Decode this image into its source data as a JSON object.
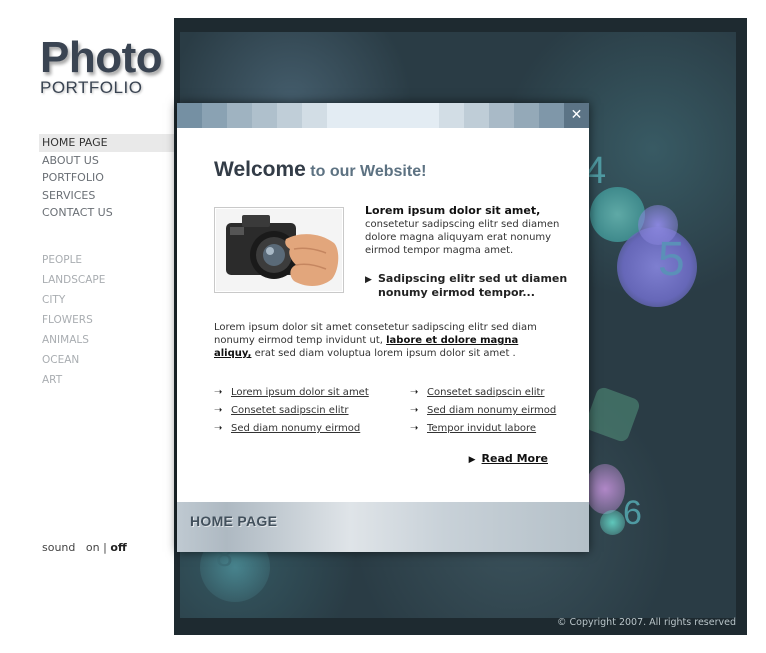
{
  "logo": {
    "title": "Photo",
    "subtitle": "PORTFOLIO"
  },
  "main_nav": [
    {
      "label": "HOME PAGE",
      "active": true
    },
    {
      "label": "ABOUT US"
    },
    {
      "label": "PORTFOLIO"
    },
    {
      "label": "SERVICES"
    },
    {
      "label": "CONTACT US"
    }
  ],
  "categories": [
    "PEOPLE",
    "LANDSCAPE",
    "CITY",
    "FLOWERS",
    "ANIMALS",
    "OCEAN",
    "ART"
  ],
  "sound": {
    "label": "sound",
    "on": "on",
    "separator": "|",
    "off": "off"
  },
  "stage": {
    "numbers": [
      "4",
      "5",
      "6",
      "8"
    ],
    "copyright": "© Copyright 2007. All rights reserved"
  },
  "modal": {
    "close_symbol": "✕",
    "welcome_bold": "Welcome",
    "welcome_rest": "to our Website!",
    "intro_lead": "Lorem ipsum dolor sit amet,",
    "intro_text": "consetetur sadipscing elitr sed diamen dolore magna aliquyam erat  nonumy eirmod tempor magma amet.",
    "bullet": "Sadipscing elitr sed ut diamen nonumy eirmod tempor...",
    "para_text": "Lorem ipsum dolor sit amet consetetur sadipscing elitr sed diam nonumy eirmod temp invidunt ut,",
    "para_link": "labore et dolore magna aliquy,",
    "para_end": "erat sed diam voluptua lorem ipsum dolor sit amet .",
    "links_left": [
      "Lorem ipsum dolor sit amet",
      "Consetet sadipscin elitr",
      "Sed diam nonumy eirmod"
    ],
    "links_right": [
      "Consetet sadipscin elitr",
      "Sed diam nonumy eirmod",
      "Tempor invidut labore"
    ],
    "arrow": "➝",
    "read_more": "Read More",
    "footer_title": "HOME PAGE"
  }
}
